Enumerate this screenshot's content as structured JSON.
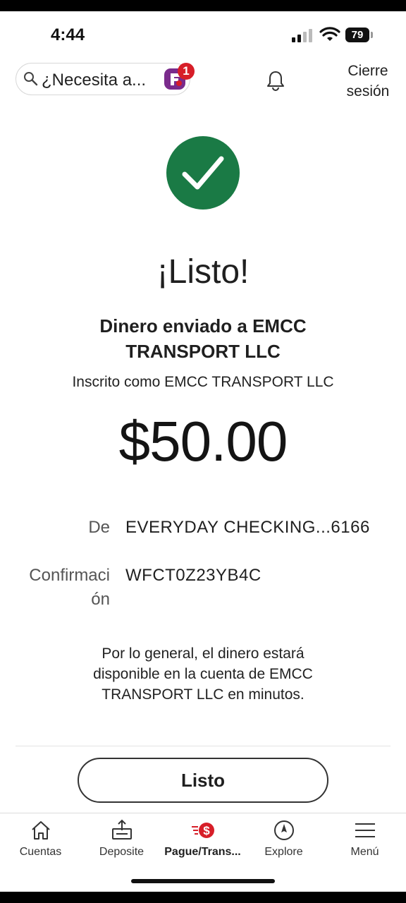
{
  "status": {
    "time": "4:44",
    "battery": "79"
  },
  "header": {
    "search_placeholder": "¿Necesita a...",
    "notification_badge": "1",
    "logout_line1": "Cierre",
    "logout_line2": "sesión"
  },
  "success": {
    "title": "¡Listo!",
    "headline_line1": "Dinero enviado a EMCC",
    "headline_line2": "TRANSPORT LLC",
    "enrolled": "Inscrito como EMCC TRANSPORT LLC",
    "amount": "$50.00",
    "from_label": "De",
    "from_value": "EVERYDAY CHECKING...6166",
    "confirmation_label_line1": "Confirmaci",
    "confirmation_label_line2": "ón",
    "confirmation_value": "WFCT0Z23YB4C",
    "note_line1": "Por lo general, el dinero estará",
    "note_line2": "disponible en la cuenta de EMCC",
    "note_line3": "TRANSPORT LLC en minutos.",
    "done_button": "Listo"
  },
  "nav": {
    "tabs": [
      {
        "label": "Cuentas",
        "icon": "home-icon"
      },
      {
        "label": "Deposite",
        "icon": "deposit-icon"
      },
      {
        "label": "Pague/Trans...",
        "icon": "pay-transfer-icon",
        "active": true
      },
      {
        "label": "Explore",
        "icon": "compass-icon"
      },
      {
        "label": "Menú",
        "icon": "menu-icon"
      }
    ]
  },
  "colors": {
    "success_green": "#1a7a45",
    "brand_red": "#d71e28",
    "brand_purple": "#7a2b8c"
  }
}
